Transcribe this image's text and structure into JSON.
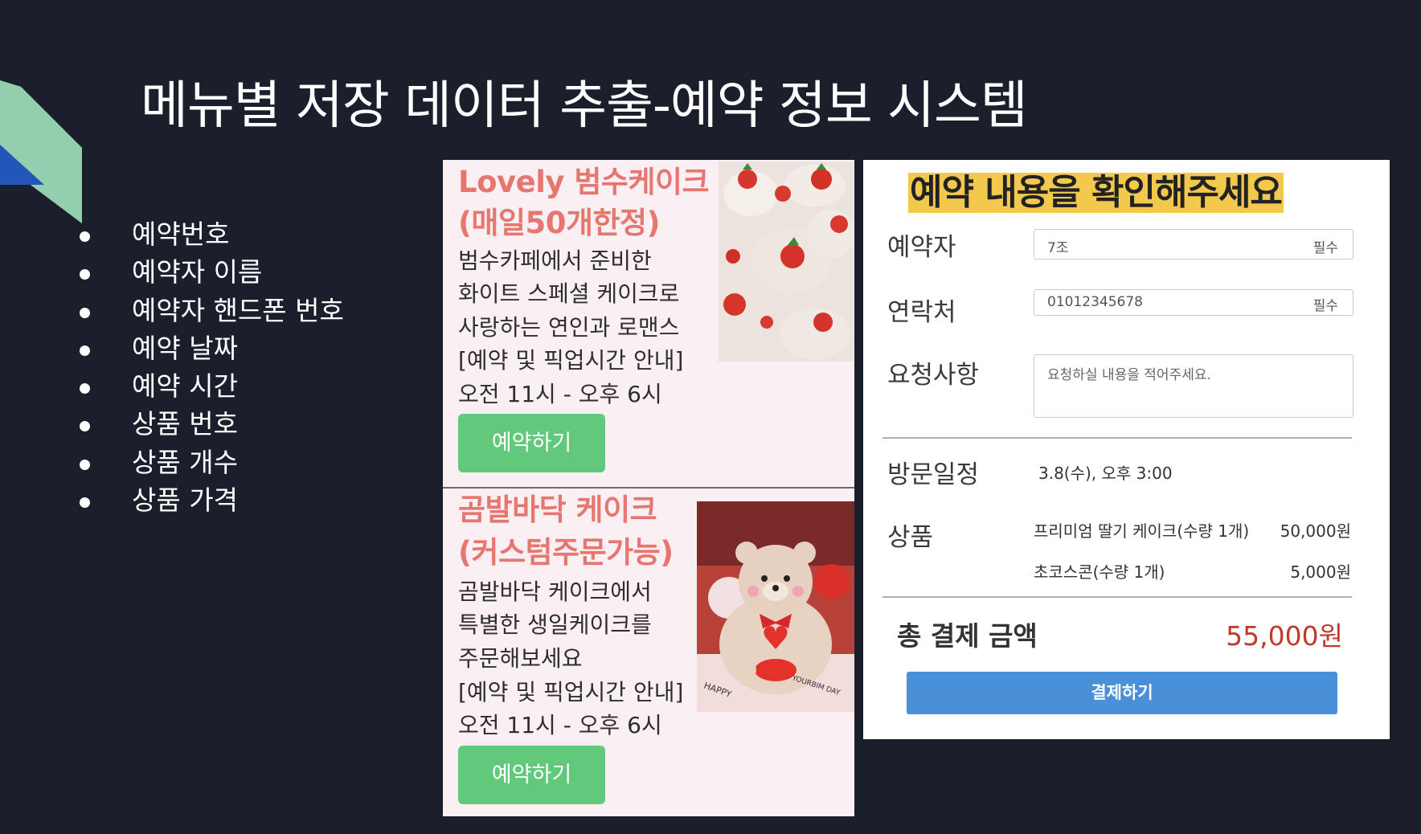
{
  "slide": {
    "title": "메뉴별 저장 데이터 추출-예약 정보 시스템",
    "bullets": [
      "예약번호",
      "예약자 이름",
      "예약자 핸드폰 번호",
      "예약 날짜",
      "예약 시간",
      "상품 번호",
      "상품 개수",
      "상품 가격"
    ]
  },
  "products": [
    {
      "title_line1": "Lovely 범수케이크",
      "title_line2": "(매일50개한정)",
      "desc": [
        "범수카페에서 준비한",
        "화이트 스페셜 케이크로",
        "사랑하는 연인과 로맨스",
        "[예약 및 픽업시간 안내]",
        "오전 11시 - 오후 6시"
      ],
      "button": "예약하기"
    },
    {
      "title_line1": "곰발바닥 케이크",
      "title_line2": "(커스텀주문가능)",
      "desc": [
        "곰발바닥 케이크에서",
        "특별한 생일케이크를",
        "주문해보세요",
        "[예약 및 픽업시간 안내]",
        "오전 11시 - 오후 6시"
      ],
      "button": "예약하기"
    }
  ],
  "confirm": {
    "title": "예약 내용을 확인해주세요",
    "reserver_label": "예약자",
    "reserver_value": "7조",
    "contact_label": "연락처",
    "contact_value": "01012345678",
    "required": "필수",
    "request_label": "요청사항",
    "request_placeholder": "요청하실 내용을 적어주세요.",
    "visit_label": "방문일정",
    "visit_value": "3.8(수), 오후 3:00",
    "product_label": "상품",
    "items": [
      {
        "name": "프리미엄 딸기 케이크(수량 1개)",
        "price": "50,000원"
      },
      {
        "name": "초코스콘(수량 1개)",
        "price": "5,000원"
      }
    ],
    "total_label": "총 결제 금액",
    "total_value": "55,000원",
    "pay_button": "결제하기",
    "photo_text": [
      "HAPPY",
      "YOURBIM DAY"
    ]
  },
  "colors": {
    "background": "#1b1f2c",
    "product_title": "#e57770",
    "reserve_button": "#62c97c",
    "highlight": "#f2c94c",
    "pay_button": "#4a90d9",
    "total_price": "#c0392b"
  }
}
